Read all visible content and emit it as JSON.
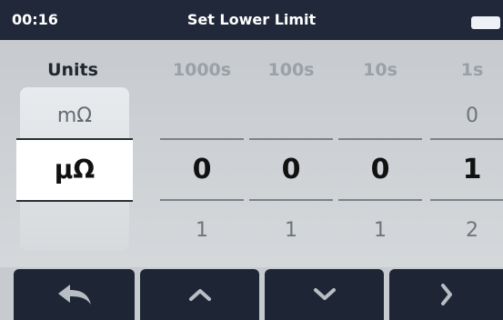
{
  "header": {
    "time": "00:16",
    "title": "Set Lower Limit",
    "battery_icon": "battery-icon"
  },
  "units": {
    "heading": "Units",
    "above": "mΩ",
    "selected": "μΩ",
    "below": ""
  },
  "digits": [
    {
      "heading": "1000s",
      "above": "",
      "current": "0",
      "below": "1"
    },
    {
      "heading": "100s",
      "above": "",
      "current": "0",
      "below": "1"
    },
    {
      "heading": "10s",
      "above": "",
      "current": "0",
      "below": "1"
    },
    {
      "heading": "1s",
      "above": "0",
      "current": "1",
      "below": "2"
    }
  ],
  "buttons": {
    "back": "back-arrow-icon",
    "up": "chevron-up-icon",
    "down": "chevron-down-icon",
    "next": "chevron-right-icon"
  },
  "colors": {
    "titlebar": "#20283a",
    "panel": "#c9ced2",
    "button": "#1e2636",
    "icon": "#b9bec4"
  }
}
